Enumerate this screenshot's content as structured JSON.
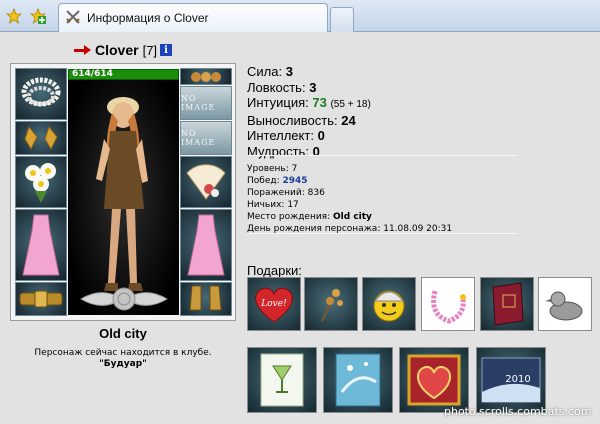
{
  "browser": {
    "tab_title": "Информация о Clover",
    "icons": [
      "star-icon",
      "plus-icon",
      "crossed-swords-icon"
    ]
  },
  "character": {
    "name": "Clover",
    "level_text": "[7]",
    "info_glyph": "i",
    "hp": "614/614",
    "hp_fraction": 1.0
  },
  "equipment": {
    "no_image_label": "NO IMAGE",
    "slots": [
      "pearl-necklace",
      "gold-earrings",
      "daisy-bouquet",
      "pink-dress",
      "gold-belt",
      "rose-fan-decoration",
      "no-image",
      "no-image",
      "flower-fan",
      "pink-dress-right",
      "gold-boots"
    ]
  },
  "stats": {
    "strength_label": "Сила:",
    "strength": "3",
    "agility_label": "Ловкость:",
    "agility": "3",
    "intuition_label": "Интуиция:",
    "intuition": "73",
    "intuition_bonus": "(55 + 18)",
    "endurance_label": "Выносливость:",
    "endurance": "24",
    "intellect_label": "Интеллект:",
    "intellect": "0",
    "wisdom_label": "Мудрость:",
    "wisdom": "0"
  },
  "details": {
    "level_label": "Уровень:",
    "level": "7",
    "wins_label": "Побед:",
    "wins": "2945",
    "losses_label": "Поражений:",
    "losses": "836",
    "draws_label": "Ничьих:",
    "draws": "17",
    "birthplace_label": "Место рождения:",
    "birthplace": "Old city",
    "birthday_label": "День рождения персонажа:",
    "birthday": "11.08.09 20:31"
  },
  "location": {
    "city": "Old city",
    "status": "Персонаж сейчас находится в клубе.",
    "club": "\"Будуар\""
  },
  "gifts": {
    "label": "Подарки:",
    "items": [
      "heart-love-icon",
      "flowers-sprig-icon",
      "smiley-icon",
      "pink-necklace-icon",
      "red-book-icon",
      "rubber-duck-icon",
      "cocktail-card-icon",
      "blue-card-icon",
      "heart-frame-icon",
      "new-year-2010-card-icon"
    ],
    "heart_text": "Love!",
    "card_year": "2010"
  },
  "watermark": "photo.scrolls.combats.com",
  "colors": {
    "hp_bar": "#1b8d0c",
    "wins": "#1e3f9a",
    "intuition": "#1d7a1d",
    "arrow": "#c80000"
  }
}
